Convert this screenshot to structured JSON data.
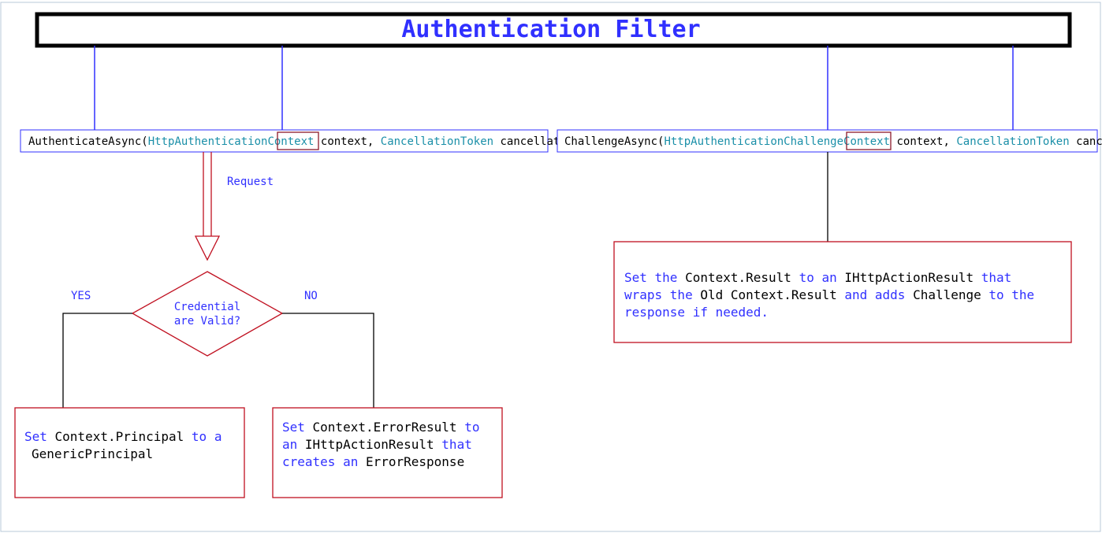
{
  "title": "Authentication Filter",
  "left_method": {
    "name": "AuthenticateAsync",
    "param1_type": "HttpAuthenticationContext",
    "param1_name": "context",
    "param2_type": "CancellationToken",
    "param2_name": "cancellationToken"
  },
  "right_method": {
    "name": "ChallengeAsync",
    "param1_type": "HttpAuthenticationChallengeContext",
    "param1_name": "context",
    "param2_type": "CancellationToken",
    "param2_name": "cancellationToken"
  },
  "request_label": "Request",
  "decision": {
    "line1": "Credential",
    "line2": "are Valid?"
  },
  "yes_label": "YES",
  "no_label": "NO",
  "yes_box": {
    "p1a": "Set ",
    "p1b": "Context.Principal ",
    "p1c": "to a ",
    "p2a": "GenericPrincipal"
  },
  "no_box": {
    "p1a": "Set ",
    "p1b": "Context.ErrorResult ",
    "p1c": "to",
    "p2a": "an ",
    "p2b": "IHttpActionResult ",
    "p2c": "that",
    "p3a": "creates an ",
    "p3b": "ErrorResponse"
  },
  "challenge_box": {
    "l1a": "Set the ",
    "l1b": "Context.Result ",
    "l1c": "to an ",
    "l1d": "IHttpActionResult ",
    "l1e": "that",
    "l2a": "wraps the ",
    "l2b": "Old Context.Result ",
    "l2c": "and adds ",
    "l2d": "Challenge ",
    "l2e": "to the",
    "l3a": "response if needed."
  }
}
